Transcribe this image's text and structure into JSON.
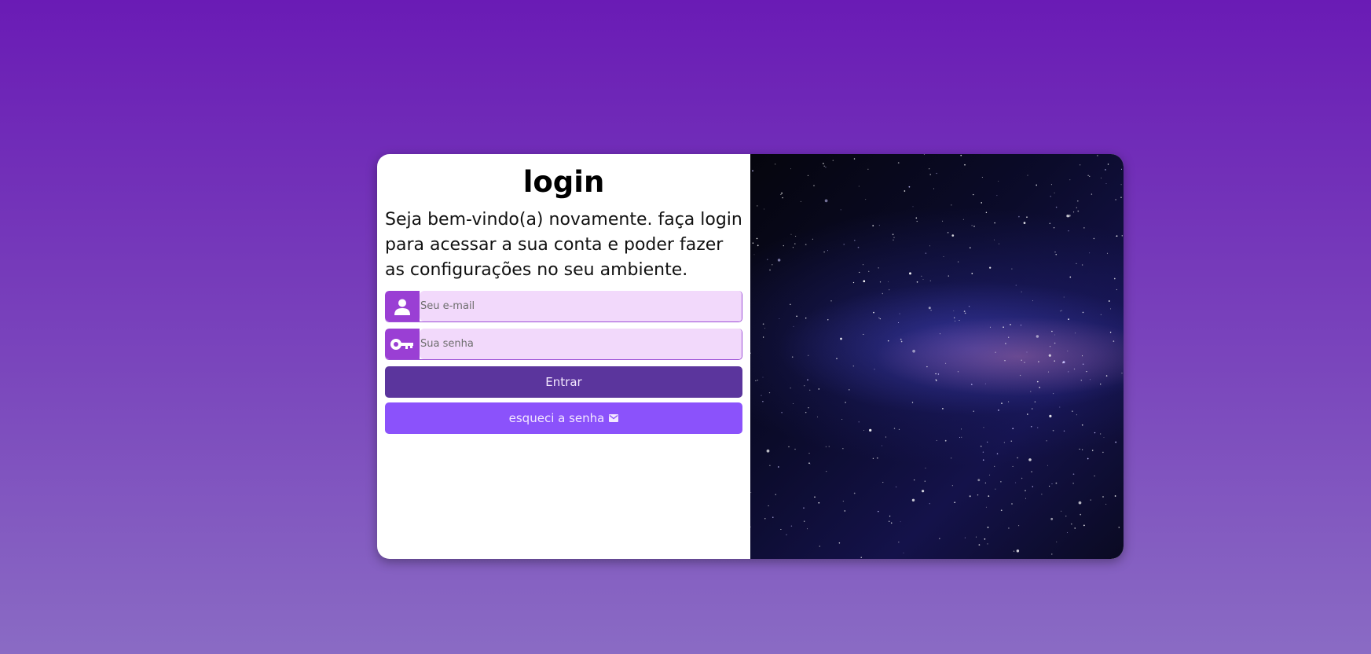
{
  "login": {
    "title": "login",
    "intro": "Seja bem-vindo(a) novamente. faça login para acessar a sua conta e poder fazer as configurações no seu ambiente.",
    "email": {
      "placeholder": "Seu e-mail",
      "value": "",
      "icon": "user-icon"
    },
    "password": {
      "placeholder": "Sua senha",
      "value": "",
      "icon": "key-icon"
    },
    "submit_label": "Entrar",
    "forgot_label": "esqueci a senha",
    "forgot_icon": "mail-icon"
  },
  "image": {
    "description_icon": "starry-sky"
  },
  "colors": {
    "background_top": "#6a1bb5",
    "background_bottom": "#8a6bc4",
    "icon_bg": "#9a3fd4",
    "input_bg": "#f2d9fb",
    "submit_bg": "#5b359d",
    "forgot_bg": "#8b52fb"
  }
}
